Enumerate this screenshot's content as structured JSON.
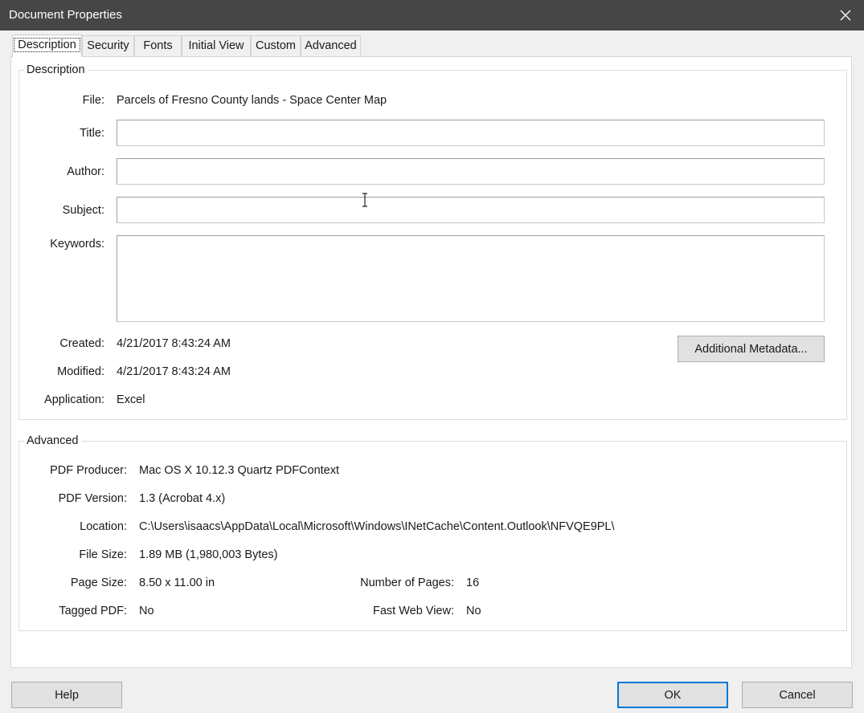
{
  "window": {
    "title": "Document Properties"
  },
  "tabs": [
    "Description",
    "Security",
    "Fonts",
    "Initial View",
    "Custom",
    "Advanced"
  ],
  "description": {
    "legend": "Description",
    "file_label": "File:",
    "file_value": "Parcels of Fresno County lands - Space Center Map",
    "title_label": "Title:",
    "title_value": "",
    "author_label": "Author:",
    "author_value": "",
    "subject_label": "Subject:",
    "subject_value": "",
    "keywords_label": "Keywords:",
    "keywords_value": "",
    "created_label": "Created:",
    "created_value": "4/21/2017 8:43:24 AM",
    "modified_label": "Modified:",
    "modified_value": "4/21/2017 8:43:24 AM",
    "application_label": "Application:",
    "application_value": "Excel",
    "metadata_button": "Additional Metadata..."
  },
  "advanced": {
    "legend": "Advanced",
    "producer_label": "PDF Producer:",
    "producer_value": "Mac OS X 10.12.3 Quartz PDFContext",
    "version_label": "PDF Version:",
    "version_value": "1.3 (Acrobat 4.x)",
    "location_label": "Location:",
    "location_value": "C:\\Users\\isaacs\\AppData\\Local\\Microsoft\\Windows\\INetCache\\Content.Outlook\\NFVQE9PL\\",
    "filesize_label": "File Size:",
    "filesize_value": "1.89 MB (1,980,003 Bytes)",
    "pagesize_label": "Page Size:",
    "pagesize_value": "8.50 x 11.00 in",
    "numpages_label": "Number of Pages:",
    "numpages_value": "16",
    "tagged_label": "Tagged PDF:",
    "tagged_value": "No",
    "fastweb_label": "Fast Web View:",
    "fastweb_value": "No"
  },
  "footer": {
    "help": "Help",
    "ok": "OK",
    "cancel": "Cancel"
  },
  "icons": {
    "close": "close-icon",
    "cursor": "text-cursor-icon"
  }
}
